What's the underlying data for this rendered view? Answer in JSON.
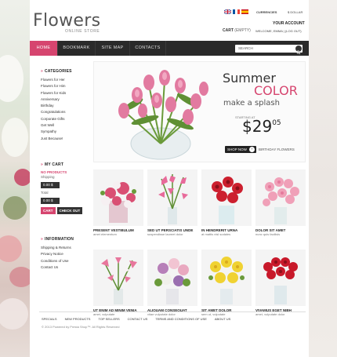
{
  "header": {
    "logo": "Flowers",
    "tagline": "ONLINE STORE",
    "currencies_label": "CURRENCIES",
    "currency_value": "$ DOLLAR",
    "cart_label": "CART",
    "cart_status": "(EMPTY)",
    "account_title": "YOUR ACCOUNT",
    "welcome_text": "WELCOME, EMMA | (LOG OUT)",
    "flags": [
      "flag-uk-icon",
      "flag-france-icon",
      "flag-spain-icon"
    ]
  },
  "nav": {
    "items": [
      "HOME",
      "BOOKMARK",
      "SITE MAP",
      "CONTACTS"
    ],
    "search_placeholder": "SEARCH"
  },
  "sidebar": {
    "categories_title": "CATEGORIES",
    "categories": [
      "Flowers for Her",
      "Flowers for Him",
      "Flowers for Kids",
      "Anniversary",
      "Birthday",
      "Congratulations",
      "Corporate Gifts",
      "Get Well",
      "Sympathy",
      "Just Because!"
    ],
    "cart_title": "MY CART",
    "cart_empty": "NO PRODUCTS",
    "shipping_label": "Shipping",
    "shipping_value": "0.00 $",
    "total_label": "Total",
    "total_value": "0.00 $",
    "cart_button": "CART",
    "checkout_button": "CHECK OUT",
    "info_title": "INFORMATION",
    "info_links": [
      "Shipping & Returns",
      "Privacy Notice",
      "Conditions of Use",
      "Contact Us"
    ]
  },
  "banner": {
    "line1": "Summer",
    "line2": "COLOR",
    "line3": "make a splash",
    "starting_at": "STARTING AT",
    "price_main": "$29",
    "price_cents": "05",
    "shop_now": "SHOP NOW",
    "subtitle": "BIRTHDAY FLOWERS"
  },
  "products": [
    {
      "name": "PRESENT VESTIBULUM",
      "desc": "amet elementum"
    },
    {
      "name": "SED UT PERSCIATIS UNDE",
      "desc": "suspendisse laoreet dolor"
    },
    {
      "name": "IN HENDRERIT URNA",
      "desc": "at mattis nisl sodales"
    },
    {
      "name": "DOLOR SIT AMET",
      "desc": "nunc quis facilisis"
    },
    {
      "name": "UT ENIM AD MINIM VENIA",
      "desc": "amet, vulputate"
    },
    {
      "name": "ALIQUAM CONSEQUAT",
      "desc": "vitae vulputate dolor"
    },
    {
      "name": "SIT AMET DOLOR",
      "desc": "sem ut, vulputate"
    },
    {
      "name": "VIVAMUS EGET NIBH",
      "desc": "amet, vulputate dolor"
    }
  ],
  "footer": {
    "links": [
      "SPECIALS",
      "NEW PRODUCTS",
      "TOP SELLERS",
      "CONTACT US",
      "TERMS AND CONDITIONS OF USE",
      "ABOUT US"
    ],
    "copyright": "© 2013 Powered by Presta Shop™. All Rights Reserved"
  },
  "colors": {
    "accent": "#d6456f",
    "nav_bg": "#2a2a2a",
    "text_dark": "#222222"
  }
}
